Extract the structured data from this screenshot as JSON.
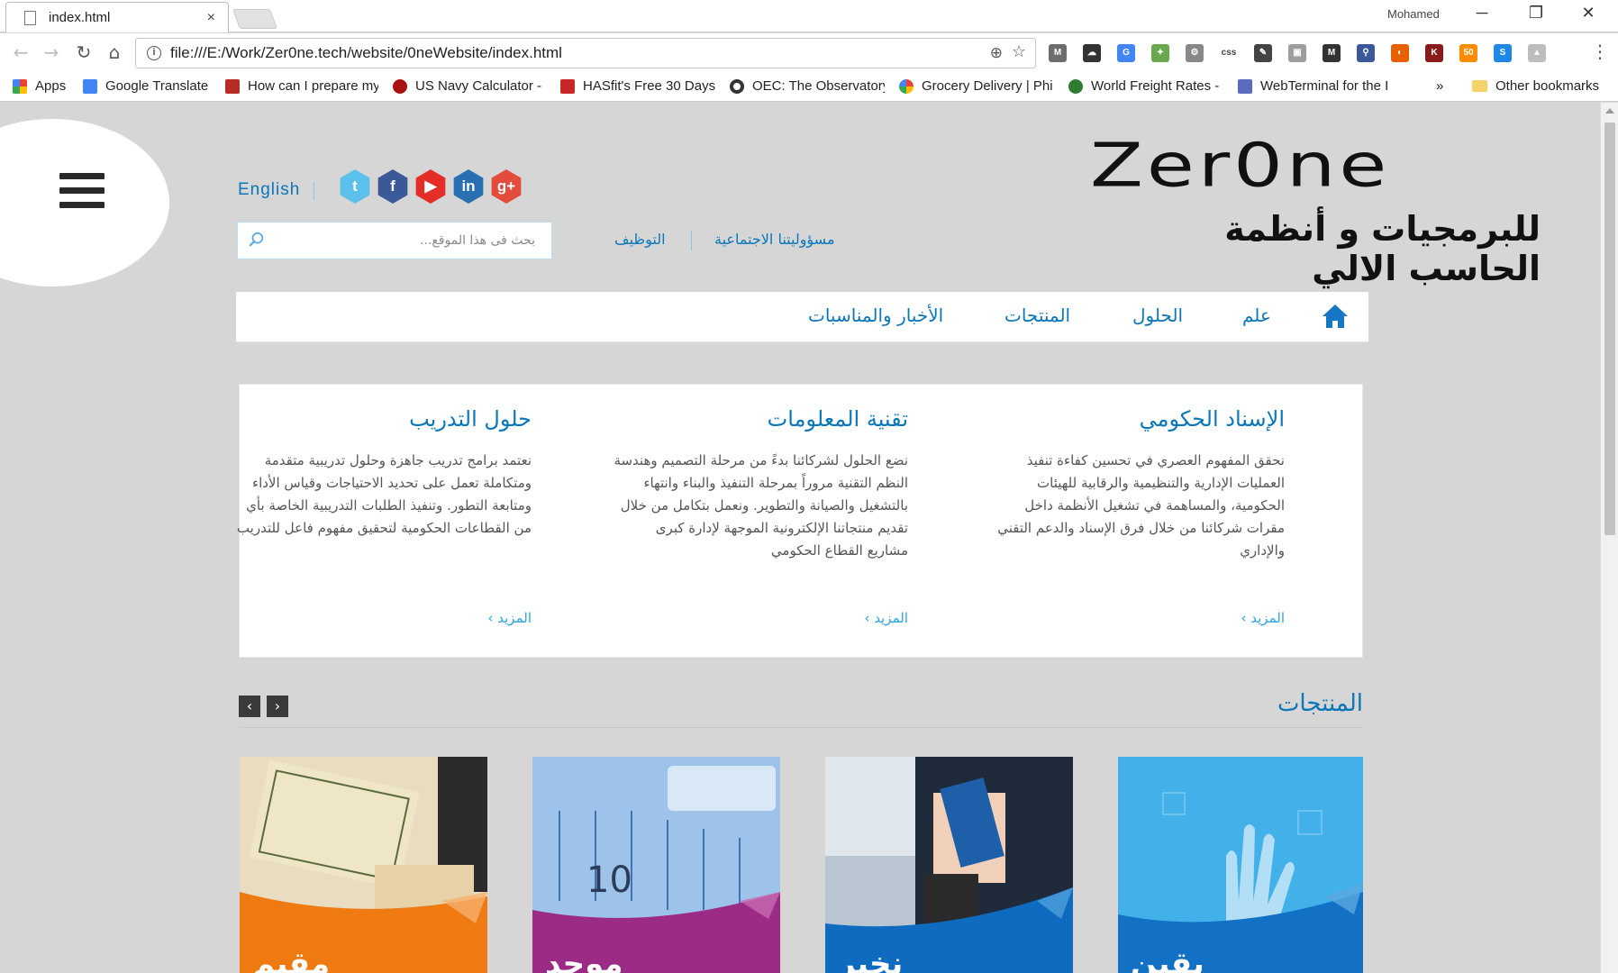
{
  "browser": {
    "tab_title": "index.html",
    "tab_close": "×",
    "profile_name": "Mohamed",
    "window_controls": {
      "minimize": "─",
      "restore": "❐",
      "close": "✕"
    },
    "nav": {
      "back": "←",
      "forward": "→",
      "reload": "↻",
      "home": "⌂"
    },
    "url": "file:///E:/Work/Zer0ne.tech/website/0neWebsite/index.html",
    "info_glyph": "i",
    "zoom_glyph": "⊕",
    "star_glyph": "☆",
    "menu_glyph": "⋮",
    "extensions": [
      {
        "name": "gmail-ext-icon",
        "color": "#6d6d6d",
        "glyph": "M"
      },
      {
        "name": "cloud-ext-icon",
        "color": "#333333",
        "glyph": "☁"
      },
      {
        "name": "translate-ext-icon",
        "color": "#4285f4",
        "glyph": "G"
      },
      {
        "name": "green-ext-icon",
        "color": "#6aa84f",
        "glyph": "✦"
      },
      {
        "name": "gear-ext-icon",
        "color": "#888888",
        "glyph": "⚙"
      },
      {
        "name": "css-ext-icon",
        "color": "#ffffff",
        "glyph": "css"
      },
      {
        "name": "eyedropper-ext-icon",
        "color": "#444444",
        "glyph": "✎"
      },
      {
        "name": "gray-ext-icon",
        "color": "#9e9e9e",
        "glyph": "▣"
      },
      {
        "name": "m-ext-icon",
        "color": "#333333",
        "glyph": "M"
      },
      {
        "name": "magnifier-ext-icon",
        "color": "#3b5998",
        "glyph": "⚲"
      },
      {
        "name": "firefox-ext-icon",
        "color": "#e66000",
        "glyph": "◐"
      },
      {
        "name": "k-ext-icon",
        "color": "#8b1a1a",
        "glyph": "K"
      },
      {
        "name": "fifty-ext-icon",
        "color": "#ff8c00",
        "glyph": "50"
      },
      {
        "name": "s-ext-icon",
        "color": "#1e88e5",
        "glyph": "S"
      },
      {
        "name": "drive-ext-icon",
        "color": "#bdbdbd",
        "glyph": "▲"
      }
    ],
    "bookmarks": [
      {
        "label": "Apps",
        "color": "#e94235"
      },
      {
        "label": "Google Translate",
        "color": "#4285f4"
      },
      {
        "label": "How can I prepare my",
        "color": "#b92b27"
      },
      {
        "label": "US Navy Calculator -",
        "color": "#a11"
      },
      {
        "label": "HASfit's Free 30 Days",
        "color": "#c62828"
      },
      {
        "label": "OEC: The Observatory",
        "color": "#333333"
      },
      {
        "label": "Grocery Delivery | Phi",
        "color": "#4285f4"
      },
      {
        "label": "World Freight Rates -",
        "color": "#2e7d32"
      },
      {
        "label": "WebTerminal for the I",
        "color": "#5c6bc0"
      }
    ],
    "bookmarks_overflow": "»",
    "other_bookmarks": "Other bookmarks"
  },
  "site": {
    "logo_text": "Zer0ne",
    "logo_tagline": "للبرمجيات و أنظمة الحاسب الالي",
    "language_link": "English",
    "social": [
      {
        "name": "twitter-icon",
        "glyph": "t",
        "color": "#5bc0ec"
      },
      {
        "name": "facebook-icon",
        "glyph": "f",
        "color": "#3b5998"
      },
      {
        "name": "youtube-icon",
        "glyph": "▶",
        "color": "#e52d27"
      },
      {
        "name": "linkedin-icon",
        "glyph": "in",
        "color": "#2a6fb0"
      },
      {
        "name": "googleplus-icon",
        "glyph": "g+",
        "color": "#e34b3c"
      }
    ],
    "search_placeholder": "بحث فى هذا الموقع...",
    "top_links": {
      "responsibility": "مسؤوليتنا الاجتماعية",
      "careers": "التوظيف"
    },
    "nav": {
      "about": "علم",
      "solutions": "الحلول",
      "products": "المنتجات",
      "news": "الأخبار والمناسبات"
    },
    "features": [
      {
        "title": "الإسناد الحكومي",
        "text": "نحقق المفهوم العصري في تحسين كفاءة تنفيذ العمليات الإدارية والتنظيمية والرقابية للهيئات الحكومية، والمساهمة في تشغيل الأنظمة داخل مقرات شركائنا من خلال فرق الإسناد والدعم التقني والإداري",
        "more": "المزيد ›"
      },
      {
        "title": "تقنية المعلومات",
        "text": "نضع الحلول لشركائنا بدءً من مرحلة التصميم وهندسة النظم التقنية مروراً بمرحلة التنفيذ والبناء وانتهاء بالتشغيل والصيانة والتطوير. ونعمل بتكامل من خلال تقديم منتجاتنا الإلكترونية الموجهة لإدارة كبرى مشاريع القطاع الحكومي",
        "more": "المزيد ›"
      },
      {
        "title": "حلول التدريب",
        "text": "نعتمد برامج تدريب جاهزة وحلول تدريبية متقدمة ومتكاملة تعمل على تحديد الاحتياجات وقياس الأداء ومتابعة التطور. وتنفيذ الطلبات التدريبية الخاصة بأي من القطاعات الحكومية لتحقيق مفهوم فاعل للتدريب",
        "more": "المزيد ›"
      }
    ],
    "products_title": "المنتجات",
    "slider": {
      "prev": "‹",
      "next": "›"
    },
    "products": [
      {
        "label": "يقين",
        "color": "#1271c4"
      },
      {
        "label": "نخبر",
        "color": "#0e6bbf"
      },
      {
        "label": "موحد",
        "color": "#9c2b86"
      },
      {
        "label": "مقيم",
        "color": "#ef7a12"
      }
    ]
  }
}
